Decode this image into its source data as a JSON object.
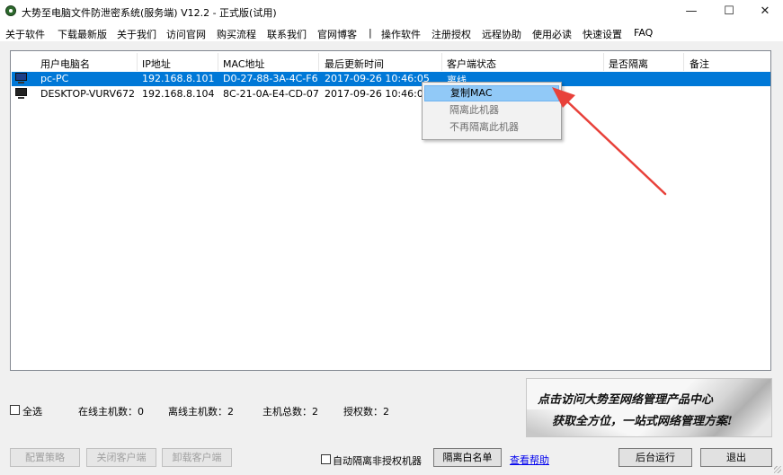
{
  "window": {
    "title": "大势至电脑文件防泄密系统(服务端) V12.2 - 正式版(试用)",
    "minimize": "—",
    "maximize": "☐",
    "close": "✕"
  },
  "menu": [
    "关于软件",
    "下载最新版",
    "关于我们",
    "访问官网",
    "购买流程",
    "联系我们",
    "官网博客",
    "|",
    "操作软件",
    "注册授权",
    "远程协助",
    "使用必读",
    "快速设置",
    "FAQ"
  ],
  "table": {
    "headers": [
      "用户电脑名",
      "IP地址",
      "MAC地址",
      "最后更新时间",
      "客户端状态",
      "是否隔离",
      "备注"
    ],
    "rows": [
      {
        "name": "pc-PC",
        "ip": "192.168.8.101",
        "mac": "D0-27-88-3A-4C-F6",
        "time": "2017-09-26 10:46:05",
        "status": "离线",
        "isolated": "",
        "note": ""
      },
      {
        "name": "DESKTOP-VURV672",
        "ip": "192.168.8.104",
        "mac": "8C-21-0A-E4-CD-07",
        "time": "2017-09-26 10:46:07",
        "status": "",
        "isolated": "",
        "note": ""
      }
    ]
  },
  "context_menu": [
    "复制MAC",
    "隔离此机器",
    "不再隔离此机器"
  ],
  "stats": {
    "select_all": "全选",
    "online": "在线主机数：0",
    "offline": "离线主机数：2",
    "total": "主机总数：2",
    "licensed": "授权数：2"
  },
  "banner": {
    "line1": "点击访问大势至网络管理产品中心",
    "line2": "获取全方位，一站式网络管理方案!"
  },
  "buttons": {
    "config_policy": "配置策略",
    "close_client": "关闭客户端",
    "uninstall_client": "卸载客户端",
    "auto_isolate": "自动隔离非授权机器",
    "isolation_whitelist": "隔离白名单",
    "help": "查看帮助",
    "run_background": "后台运行",
    "exit": "退出"
  },
  "colors": {
    "selection": "#0078d7",
    "arrow": "#e8413a",
    "link": "#0000ee"
  }
}
